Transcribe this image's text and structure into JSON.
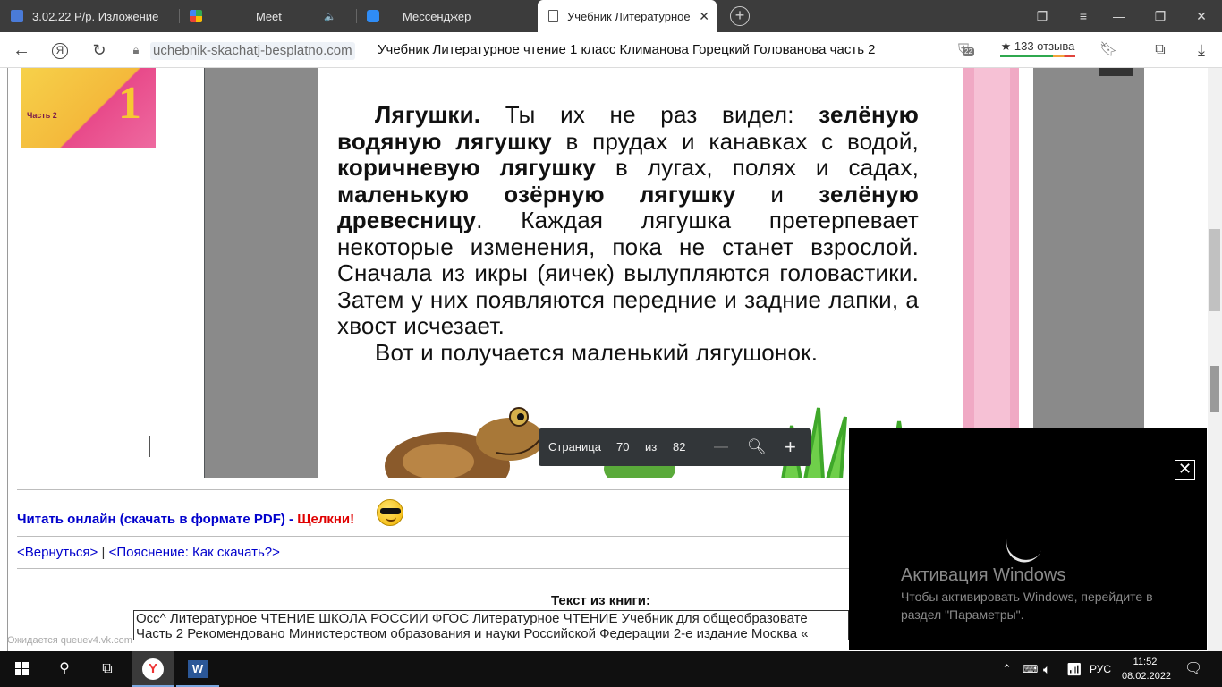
{
  "browser": {
    "tabs": [
      {
        "label": "3.02.22 Р/р. Изложение",
        "icon": "classroom-icon"
      },
      {
        "label": "Meet",
        "icon": "meet-icon",
        "audio": "🔈"
      },
      {
        "label": "Мессенджер",
        "icon": "messenger-icon"
      },
      {
        "label": "Учебник Литературное",
        "icon": "page-icon"
      }
    ],
    "url": "uchebnik-skachatj-besplatno.com",
    "page_title": "Учебник Литературное чтение 1 класс Климанова Горецкий Голованова часть 2",
    "reviews_label": "★ 133 отзыва",
    "protect_count": "22"
  },
  "cover": {
    "number": "1",
    "part": "Часть 2"
  },
  "page_text": {
    "p1_parts": [
      {
        "t": "Лягушки.",
        "b": true
      },
      {
        "t": " Ты их не раз видел: ",
        "b": false
      },
      {
        "t": "зелёную водяную лягушку",
        "b": true
      },
      {
        "t": " в прудах и канавках с водой, ",
        "b": false
      },
      {
        "t": "коричневую лягушку",
        "b": true
      },
      {
        "t": " в лугах, полях и садах, ",
        "b": false
      },
      {
        "t": "маленькую озёрную лягушку",
        "b": true
      },
      {
        "t": " и ",
        "b": false
      },
      {
        "t": "зелёную древесницу",
        "b": true
      },
      {
        "t": ". Каждая лягушка претерпевает некоторые изменения, пока не станет взрослой. Сначала из икры (яичек) вылупляются головастики. Затем у них появляются передние и задние лапки, а хвост исчезает.",
        "b": false
      }
    ],
    "p2": "Вот и получается маленький лягушонок."
  },
  "pdf_toolbar": {
    "page_label": "Страница",
    "page_current": "70",
    "of_label": "из",
    "page_total": "82",
    "zoom_out": "—",
    "zoom_in": "+"
  },
  "links": {
    "read_online": "Читать онлайн (скачать в формате PDF) - ",
    "click": "Щелкни!",
    "back": "<Вернуться>",
    "separator": "|",
    "howto": "<Пояснение: Как скачать?>"
  },
  "book_text": {
    "title": "Текст из книги:",
    "line1": "Осс^ Литературное ЧТЕНИЕ ШКОЛА РОССИИ ФГОС Литературное ЧТЕНИЕ Учебник для общеобразовате",
    "line2": "Часть 2 Рекомендовано Министерством образования и науки Российской Федерации 2-е издание Москва «"
  },
  "status_text": "Ожидается queuev4.vk.com",
  "activation": {
    "title": "Активация Windows",
    "body": "Чтобы активировать Windows, перейдите в раздел \"Параметры\"."
  },
  "taskbar": {
    "lang": "РУС",
    "time": "11:52",
    "date": "08.02.2022"
  },
  "colors": {
    "link": "#0000cc",
    "accent_red": "#e00000",
    "tabbar": "#3c3c3c",
    "taskbar": "#101010"
  }
}
